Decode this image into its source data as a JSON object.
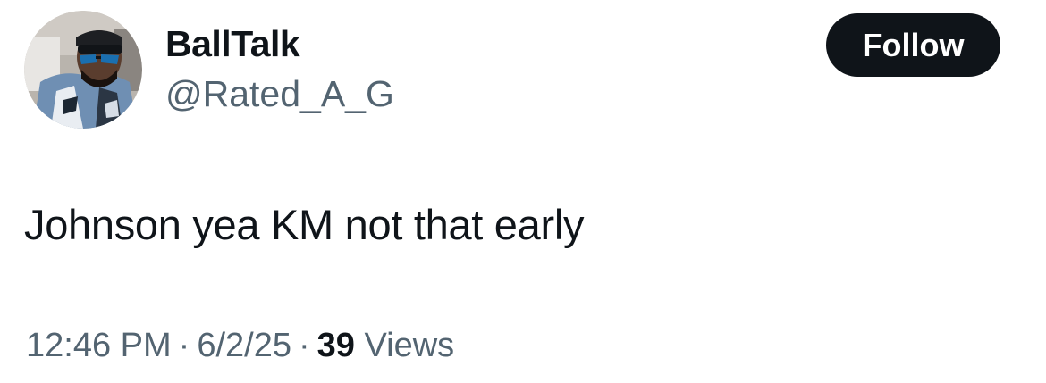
{
  "author": {
    "display_name": "BallTalk",
    "handle": "@Rated_A_G",
    "avatar_icon": "profile-photo"
  },
  "follow_label": "Follow",
  "tweet": {
    "text": "Johnson yea KM not that early"
  },
  "meta": {
    "time": "12:46 PM",
    "separator": "·",
    "date": "6/2/25",
    "views_count": "39",
    "views_label": "Views"
  },
  "colors": {
    "primary_text": "#0f1419",
    "secondary_text": "#536471",
    "follow_bg": "#0f1419",
    "follow_text": "#ffffff"
  }
}
